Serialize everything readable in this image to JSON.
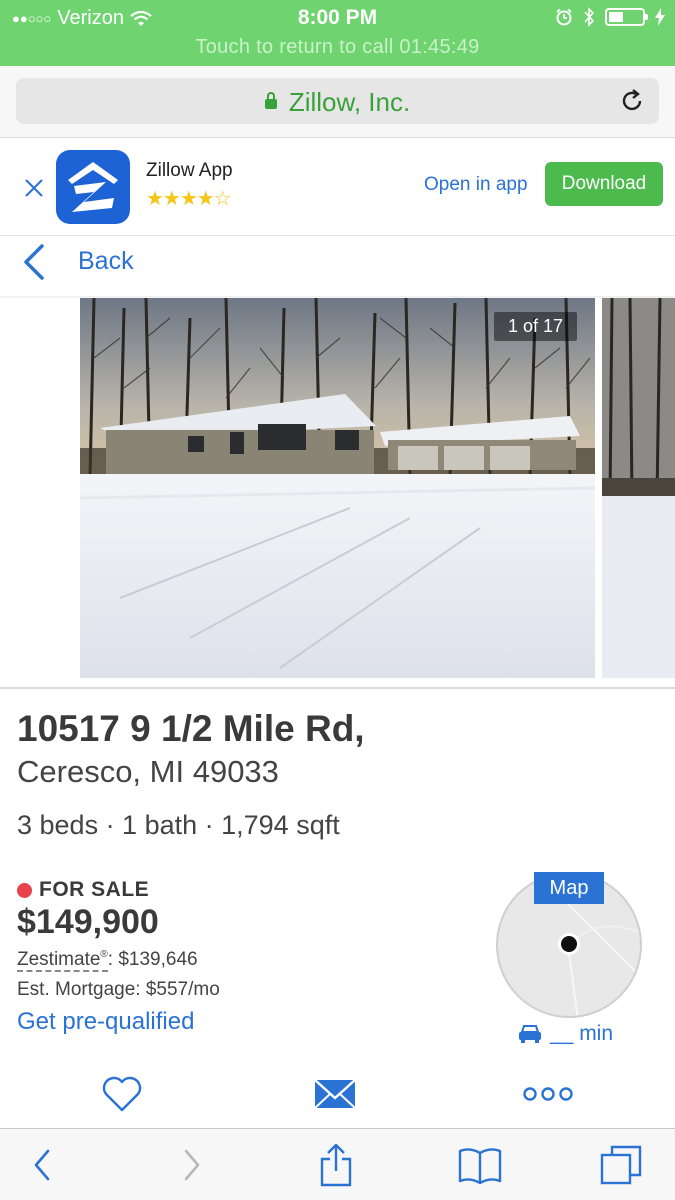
{
  "status_bar": {
    "carrier": "Verizon",
    "time": "8:00 PM",
    "call_banner": "Touch to return to call 01:45:49",
    "battery_level": 0.45
  },
  "url_bar": {
    "site_name": "Zillow, Inc."
  },
  "app_banner": {
    "app_name": "Zillow App",
    "stars": "★★★★☆",
    "rating": 4,
    "open_label": "Open in app",
    "download_label": "Download"
  },
  "nav": {
    "back_label": "Back"
  },
  "gallery": {
    "counter": "1 of 17"
  },
  "listing": {
    "address_line1": "10517 9 1/2 Mile Rd,",
    "address_line2": "Ceresco, MI 49033",
    "facts": "3 beds · 1 bath · 1,794 sqft",
    "status": "FOR SALE",
    "price": "$149,900",
    "zestimate_label": "Zestimate",
    "zestimate_mark": "®",
    "zestimate_value": ": $139,646",
    "mortgage": "Est. Mortgage: $557/mo",
    "prequal_link": "Get pre-qualified"
  },
  "map": {
    "label": "Map",
    "commute": "__ min"
  },
  "colors": {
    "status_green": "#6fd36f",
    "link_blue": "#2a72d4",
    "download_green": "#4cba4c",
    "sale_red": "#e8424a"
  },
  "icons": [
    "lock-icon",
    "reload-icon",
    "close-icon",
    "zillow-logo-icon",
    "back-chevron-icon",
    "car-icon",
    "heart-icon",
    "mail-icon",
    "more-icon",
    "share-icon",
    "bookmarks-icon",
    "tabs-icon"
  ]
}
